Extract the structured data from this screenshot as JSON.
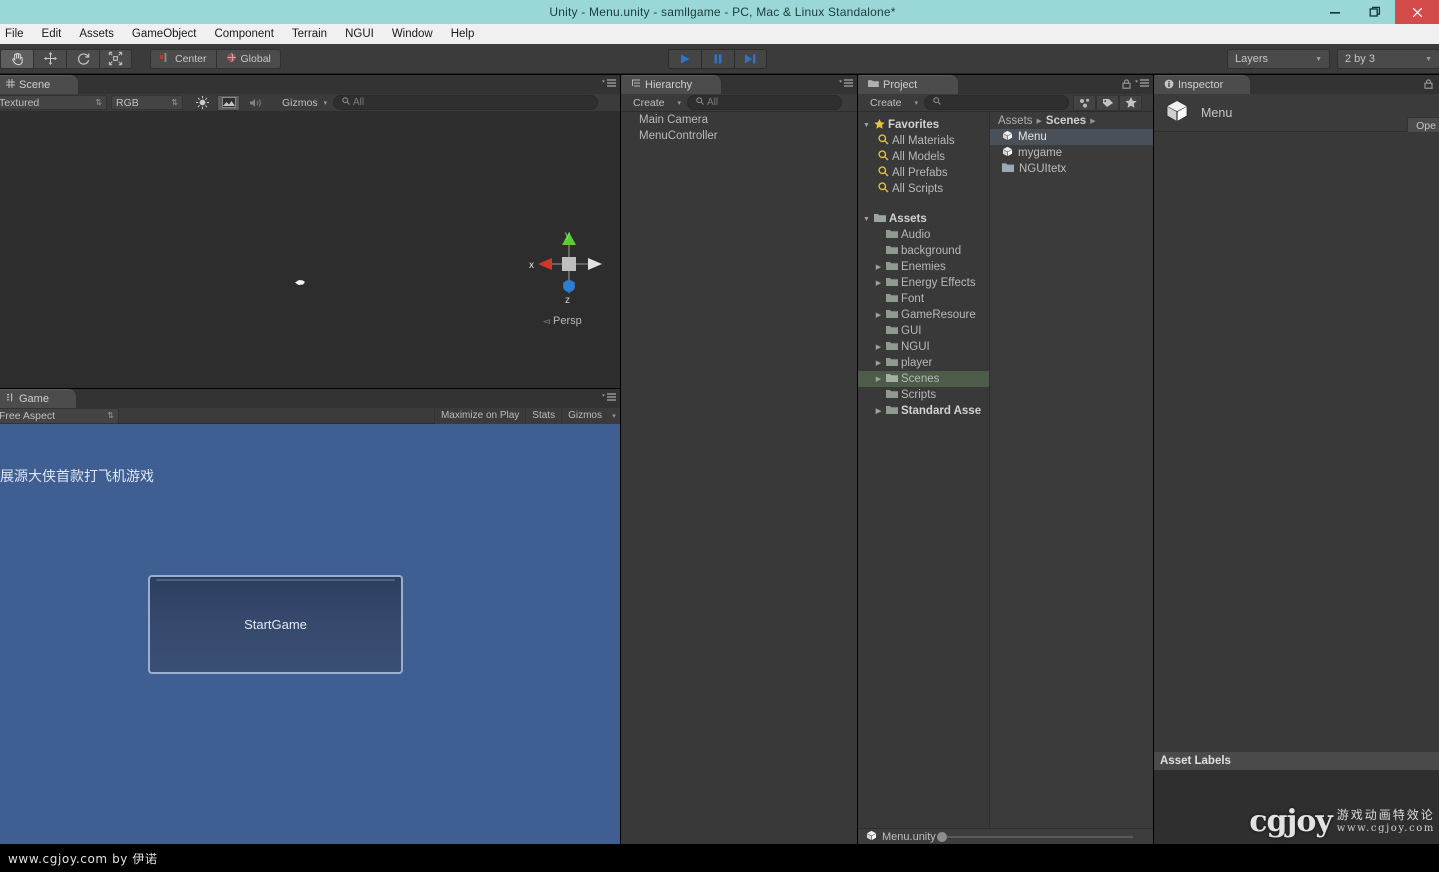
{
  "window": {
    "title": "Unity - Menu.unity - samllgame - PC, Mac & Linux Standalone*",
    "minimize_label": "minimize",
    "restore_label": "restore",
    "close_label": "close"
  },
  "menubar": {
    "items": [
      "File",
      "Edit",
      "Assets",
      "GameObject",
      "Component",
      "Terrain",
      "NGUI",
      "Window",
      "Help"
    ]
  },
  "toolbar": {
    "tools": [
      "hand-tool",
      "move-tool",
      "rotate-tool",
      "scale-tool"
    ],
    "pivot_mode": "Center",
    "pivot_rotation": "Global",
    "play": "play-button",
    "pause": "pause-button",
    "step": "step-button",
    "layers_label": "Layers",
    "layout_label": "2 by 3"
  },
  "scene": {
    "tab_label": "Scene",
    "draw_mode": "Textured",
    "render_mode": "RGB",
    "gizmos_label": "Gizmos",
    "search_placeholder": "All",
    "axis_x": "x",
    "axis_y": "y",
    "axis_z": "z",
    "projection": "Persp"
  },
  "game": {
    "tab_label": "Game",
    "aspect": "Free Aspect",
    "maximize_label": "Maximize on Play",
    "stats_label": "Stats",
    "gizmos_label": "Gizmos",
    "title_text": "展源大侠首款打飞机游戏",
    "start_button_label": "StartGame"
  },
  "hierarchy": {
    "tab_label": "Hierarchy",
    "create_label": "Create",
    "search_placeholder": "All",
    "items": [
      {
        "label": "Main Camera"
      },
      {
        "label": "MenuController"
      }
    ]
  },
  "project": {
    "tab_label": "Project",
    "create_label": "Create",
    "search_placeholder": "",
    "favorites_label": "Favorites",
    "favorites": [
      {
        "label": "All Materials"
      },
      {
        "label": "All Models"
      },
      {
        "label": "All Prefabs"
      },
      {
        "label": "All Scripts"
      }
    ],
    "assets_label": "Assets",
    "folders": [
      {
        "label": "Audio",
        "arrow": false,
        "selected": false
      },
      {
        "label": "background",
        "arrow": false,
        "selected": false
      },
      {
        "label": "Enemies",
        "arrow": true,
        "selected": false
      },
      {
        "label": "Energy Effects",
        "arrow": true,
        "selected": false
      },
      {
        "label": "Font",
        "arrow": false,
        "selected": false
      },
      {
        "label": "GameResoure",
        "arrow": true,
        "selected": false
      },
      {
        "label": "GUI",
        "arrow": false,
        "selected": false
      },
      {
        "label": "NGUI",
        "arrow": true,
        "selected": false
      },
      {
        "label": "player",
        "arrow": true,
        "selected": false
      },
      {
        "label": "Scenes",
        "arrow": true,
        "selected": true
      },
      {
        "label": "Scripts",
        "arrow": false,
        "selected": false
      },
      {
        "label": "Standard Asse",
        "arrow": true,
        "selected": false
      }
    ],
    "breadcrumb": [
      "Assets",
      "Scenes"
    ],
    "assets": [
      {
        "label": "Menu",
        "icon": "unity-scene-icon",
        "selected": true
      },
      {
        "label": "mygame",
        "icon": "unity-scene-icon",
        "selected": false
      },
      {
        "label": "NGUItetx",
        "icon": "folder-icon",
        "selected": false
      }
    ],
    "status_label": "Menu.unity"
  },
  "inspector": {
    "tab_label": "Inspector",
    "asset_name": "Menu",
    "open_label": "Ope",
    "asset_labels_title": "Asset Labels"
  },
  "watermark": {
    "logo_text": "cgjoy",
    "logo_cn": "游戏动画特效论",
    "logo_url": "www.cgjoy.com",
    "bottom_text": "www.cgjoy.com by 伊诺"
  },
  "colors": {
    "titlebar": "#9ad8d8",
    "close": "#d24a4a",
    "panel_bg": "#393939",
    "game_bg": "#3f5f93",
    "selection": "#4a5057",
    "folder_selection": "#4c5c48",
    "play_blue": "#3b7bd6"
  }
}
